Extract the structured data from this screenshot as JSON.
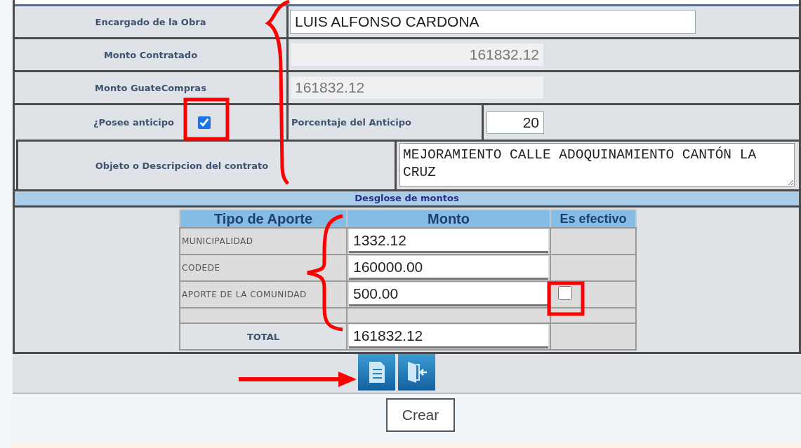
{
  "form_rows": [
    {
      "label": "Encargado de la Obra",
      "kind": "text",
      "value": "LUIS ALFONSO CARDONA"
    },
    {
      "label": "Monto Contratado",
      "kind": "readonly_right",
      "value": "161832.12"
    },
    {
      "label": "Monto GuateCompras",
      "kind": "readonly",
      "value": "161832.12"
    }
  ],
  "advance": {
    "label": "¿Posee anticipo",
    "checked": true,
    "percent_label": "Porcentaje del Anticipo",
    "percent": "20"
  },
  "description": {
    "label": "Objeto o Descripcion del contrato",
    "value": "MEJORAMIENTO CALLE ADOQUINAMIENTO CANTÓN LA CRUZ"
  },
  "breakdown": {
    "title": "Desglose de montos",
    "columns": [
      "Tipo de Aporte",
      "Monto",
      "Es efectivo"
    ],
    "rows": [
      {
        "kind": "item",
        "type": "MUNICIPALIDAD",
        "amount": "1332.12"
      },
      {
        "kind": "item",
        "type": "CODEDE",
        "amount": "160000.00"
      },
      {
        "kind": "check",
        "type": "APORTE DE LA COMUNIDAD",
        "amount": "500.00",
        "cash": false
      },
      {
        "kind": "blank"
      },
      {
        "kind": "total",
        "type": "TOTAL",
        "amount": "161832.12"
      }
    ]
  },
  "toolbar": {
    "tooltip": "Crear"
  }
}
